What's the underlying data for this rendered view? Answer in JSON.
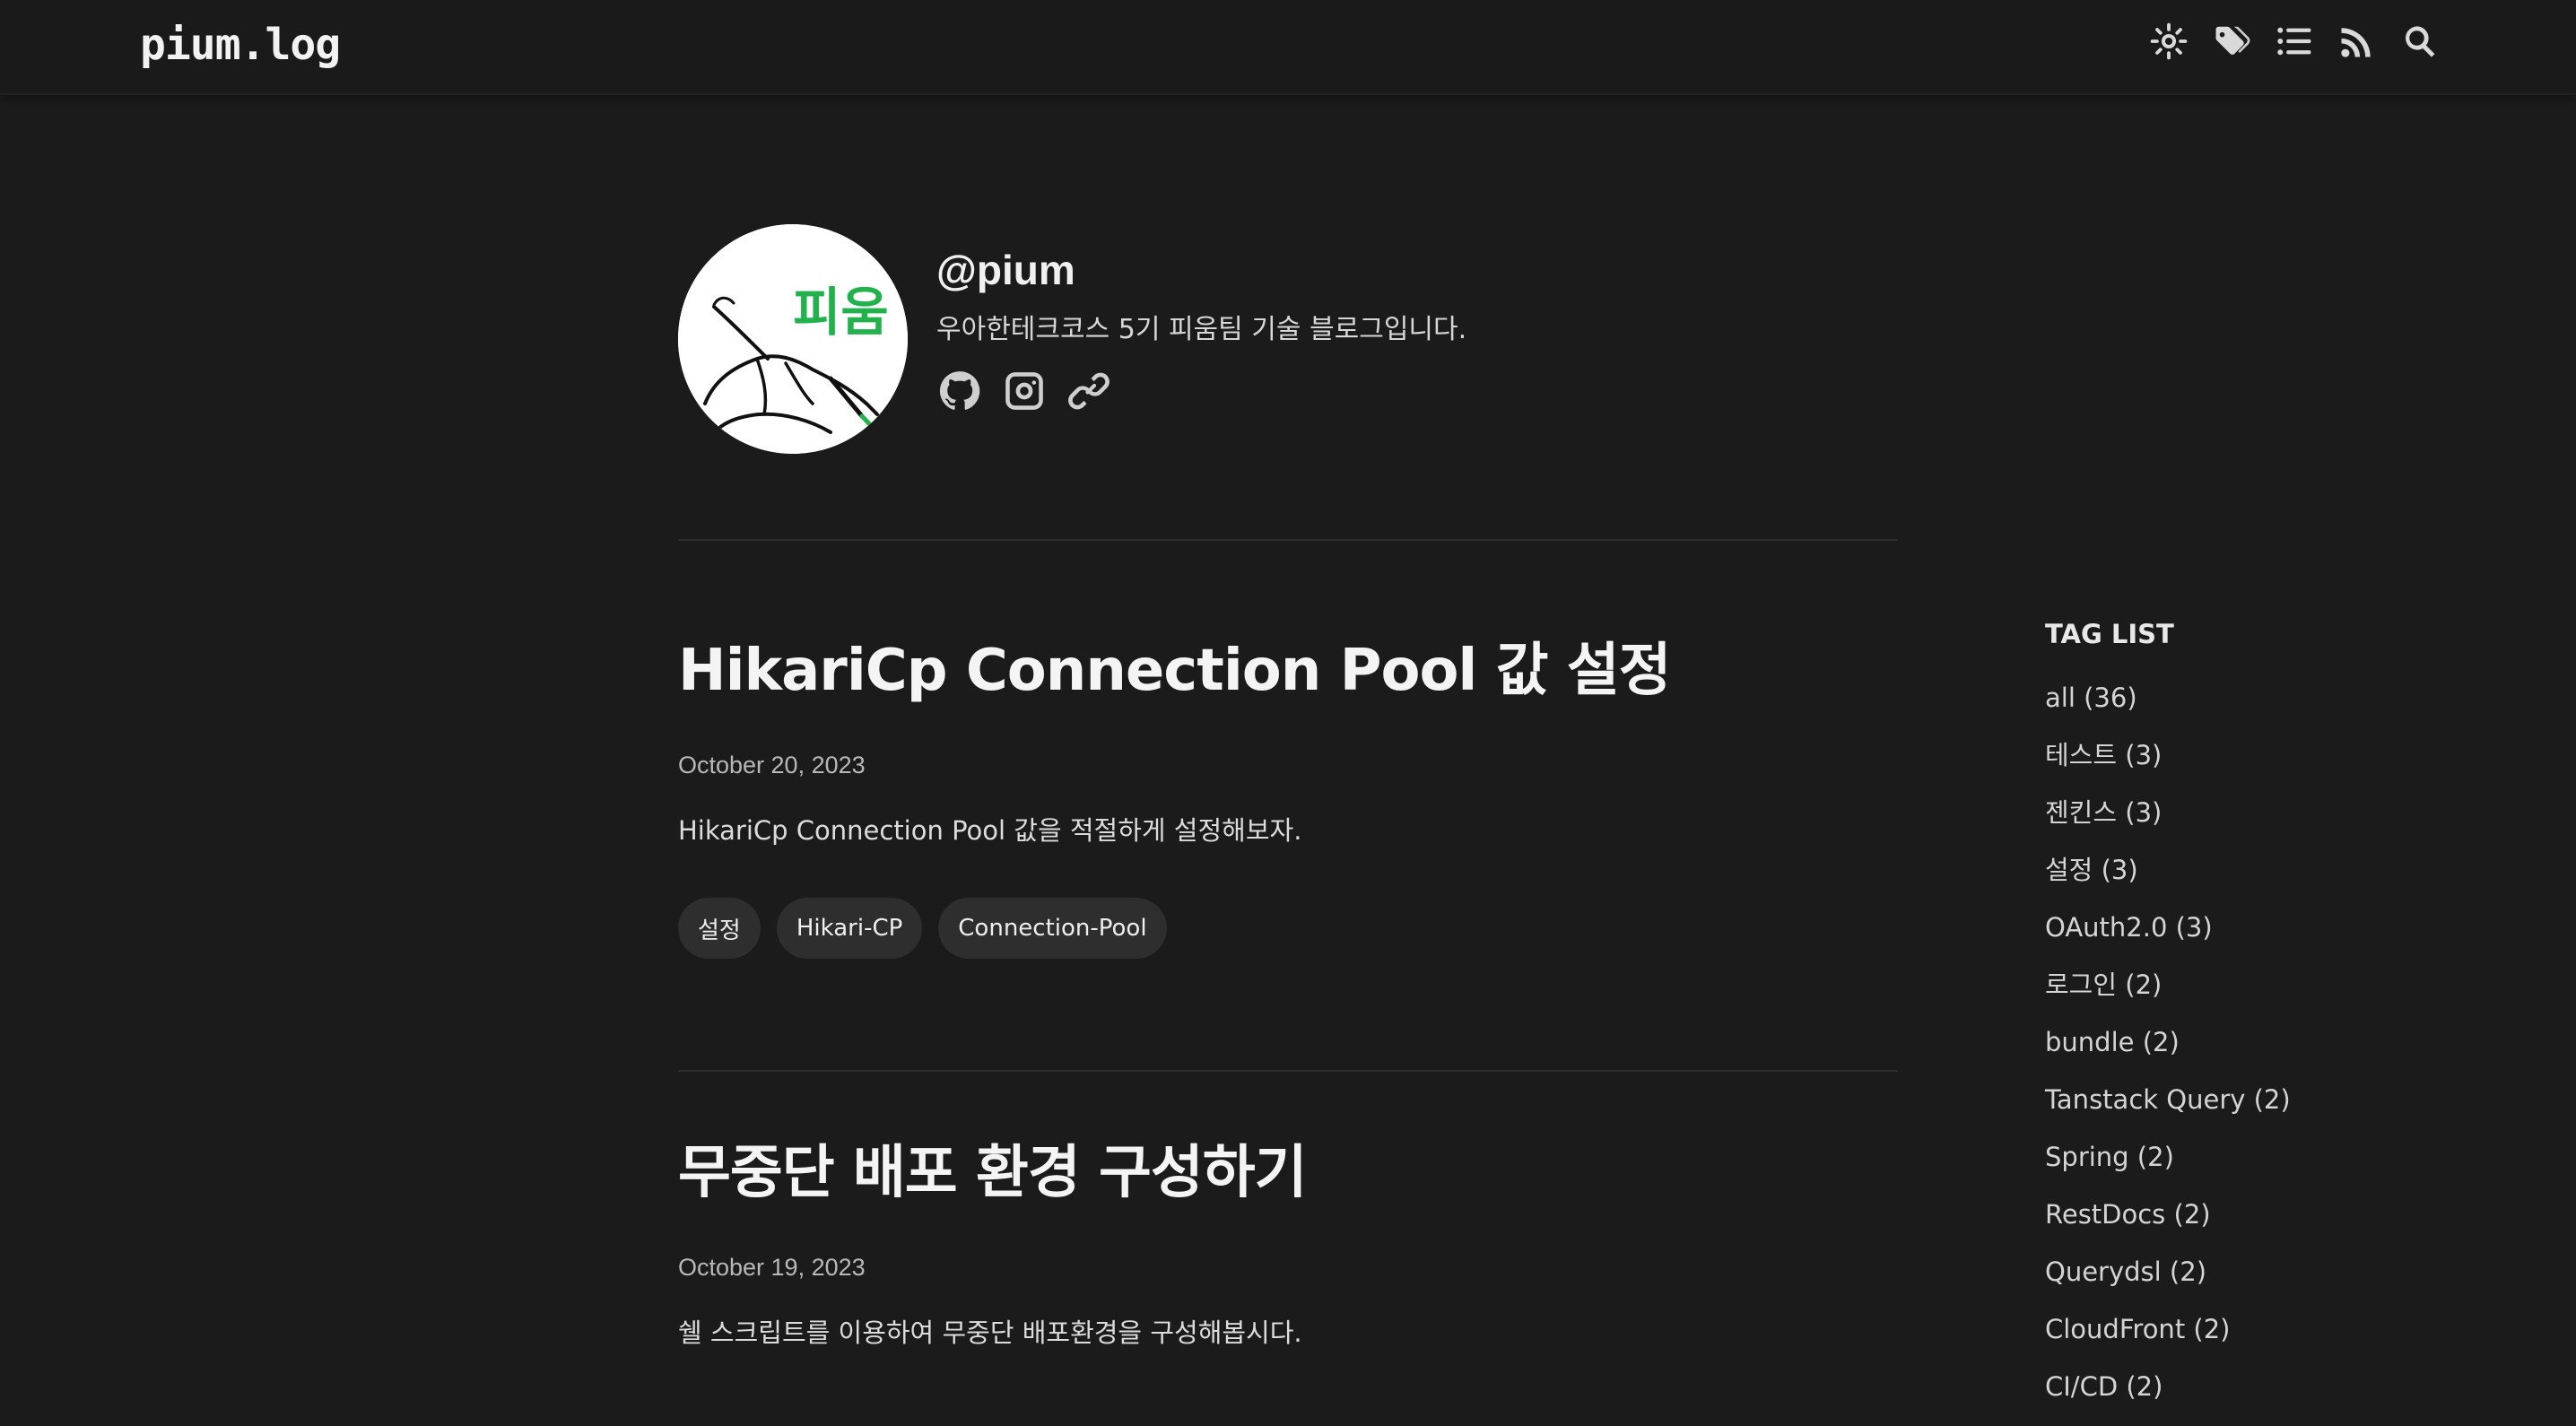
{
  "header": {
    "logo": "pium.log",
    "icons": [
      "theme-toggle-icon",
      "tags-icon",
      "list-icon",
      "rss-icon",
      "search-icon"
    ]
  },
  "profile": {
    "name": "@pium",
    "description": "우아한테크코스 5기 피움팀 기술 블로그입니다.",
    "avatar_text": "피움",
    "social_icons": [
      "github-icon",
      "instagram-icon",
      "link-icon"
    ]
  },
  "posts": [
    {
      "title": "HikariCp Connection Pool 값 설정",
      "date": "October 20, 2023",
      "summary": "HikariCp Connection Pool 값을 적절하게 설정해보자.",
      "tags": [
        "설정",
        "Hikari-CP",
        "Connection-Pool"
      ]
    },
    {
      "title": "무중단 배포 환경 구성하기",
      "date": "October 19, 2023",
      "summary": "쉘 스크립트를 이용하여 무중단 배포환경을 구성해봅시다."
    }
  ],
  "taglist": {
    "title": "TAG LIST",
    "items": [
      "all (36)",
      "테스트 (3)",
      "젠킨스 (3)",
      "설정 (3)",
      "OAuth2.0 (3)",
      "로그인 (2)",
      "bundle (2)",
      "Tanstack Query (2)",
      "Spring (2)",
      "RestDocs (2)",
      "Querydsl (2)",
      "CloudFront (2)",
      "CI/CD (2)"
    ]
  },
  "colors": {
    "background": "#1b1b1b",
    "avatar_text": "#22b24c",
    "chip": "#2e2e2e"
  }
}
